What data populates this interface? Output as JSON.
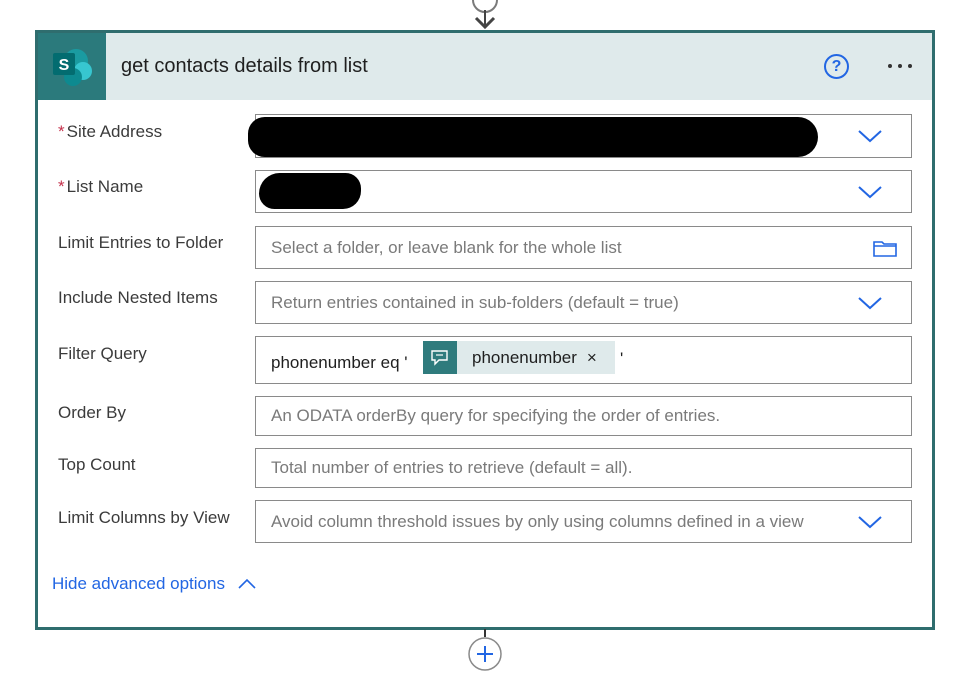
{
  "card": {
    "title": "get contacts details from list",
    "app_icon": "sharepoint-icon",
    "app_icon_letter": "S",
    "help_icon_glyph": "?",
    "accent_color": "#2f6d6e",
    "header_color": "#dfeaeb"
  },
  "fields": {
    "site_address": {
      "label": "Site Address",
      "required": "*"
    },
    "list_name": {
      "label": "List Name",
      "required": "*"
    },
    "limit_folder": {
      "label": "Limit Entries to Folder",
      "placeholder": "Select a folder, or leave blank for the whole list"
    },
    "nested_items": {
      "label": "Include Nested Items",
      "placeholder": "Return entries contained in sub-folders (default = true)"
    },
    "filter_query": {
      "label": "Filter Query",
      "prefix": "phonenumber eq '",
      "token": "phonenumber",
      "token_close": "×",
      "suffix": "'"
    },
    "order_by": {
      "label": "Order By",
      "placeholder": "An ODATA orderBy query for specifying the order of entries."
    },
    "top_count": {
      "label": "Top Count",
      "placeholder": "Total number of entries to retrieve (default = all)."
    },
    "limit_columns": {
      "label": "Limit Columns by View",
      "placeholder": "Avoid column threshold issues by only using columns defined in a view"
    }
  },
  "footer": {
    "hide_advanced": "Hide advanced options"
  }
}
